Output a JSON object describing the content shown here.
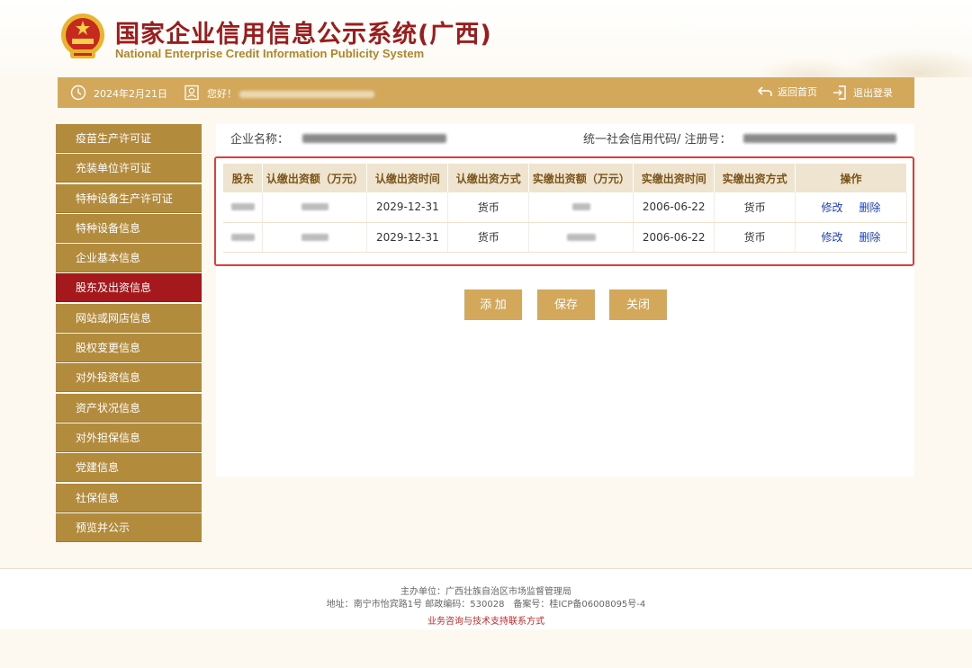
{
  "header": {
    "title": "国家企业信用信息公示系统(广西)",
    "subtitle": "National Enterprise Credit Information Publicity System"
  },
  "topbar": {
    "date": "2024年2月21日",
    "greeting": "您好！",
    "home_label": "返回首页",
    "logout_label": "退出登录"
  },
  "sidebar": {
    "items": [
      {
        "label": "疫苗生产许可证"
      },
      {
        "label": "充装单位许可证"
      },
      {
        "label": "特种设备生产许可证"
      },
      {
        "label": "特种设备信息"
      },
      {
        "label": "企业基本信息"
      },
      {
        "label": "股东及出资信息"
      },
      {
        "label": "网站或网店信息"
      },
      {
        "label": "股权变更信息"
      },
      {
        "label": "对外投资信息"
      },
      {
        "label": "资产状况信息"
      },
      {
        "label": "对外担保信息"
      },
      {
        "label": "党建信息"
      },
      {
        "label": "社保信息"
      },
      {
        "label": "预览并公示"
      }
    ],
    "active_index": 5
  },
  "company": {
    "name_label": "企业名称：",
    "code_label": "统一社会信用代码/ 注册号："
  },
  "table": {
    "headers": [
      "股东",
      "认缴出资额（万元）",
      "认缴出资时间",
      "认缴出资方式",
      "实缴出资额（万元）",
      "实缴出资时间",
      "实缴出资方式",
      "操作"
    ],
    "rows": [
      {
        "subscribed_date": "2029-12-31",
        "subscribed_method": "货币",
        "paid_date": "2006-06-22",
        "paid_method": "货币",
        "edit": "修改",
        "delete": "删除"
      },
      {
        "subscribed_date": "2029-12-31",
        "subscribed_method": "货币",
        "paid_date": "2006-06-22",
        "paid_method": "货币",
        "edit": "修改",
        "delete": "删除"
      }
    ]
  },
  "buttons": {
    "add": "添 加",
    "save": "保存",
    "close": "关闭"
  },
  "footer": {
    "sponsor": "主办单位：广西壮族自治区市场监督管理局",
    "address": "地址：南宁市怡宾路1号 邮政编码：530028　备案号：桂ICP备06008095号-4",
    "support": "业务咨询与技术支持联系方式"
  },
  "colors": {
    "gold": "#d3a85a",
    "sidebar": "#b38b3d",
    "active": "#a5191d",
    "title_red": "#9b1c1c",
    "highlight_border": "#e23b3b"
  }
}
